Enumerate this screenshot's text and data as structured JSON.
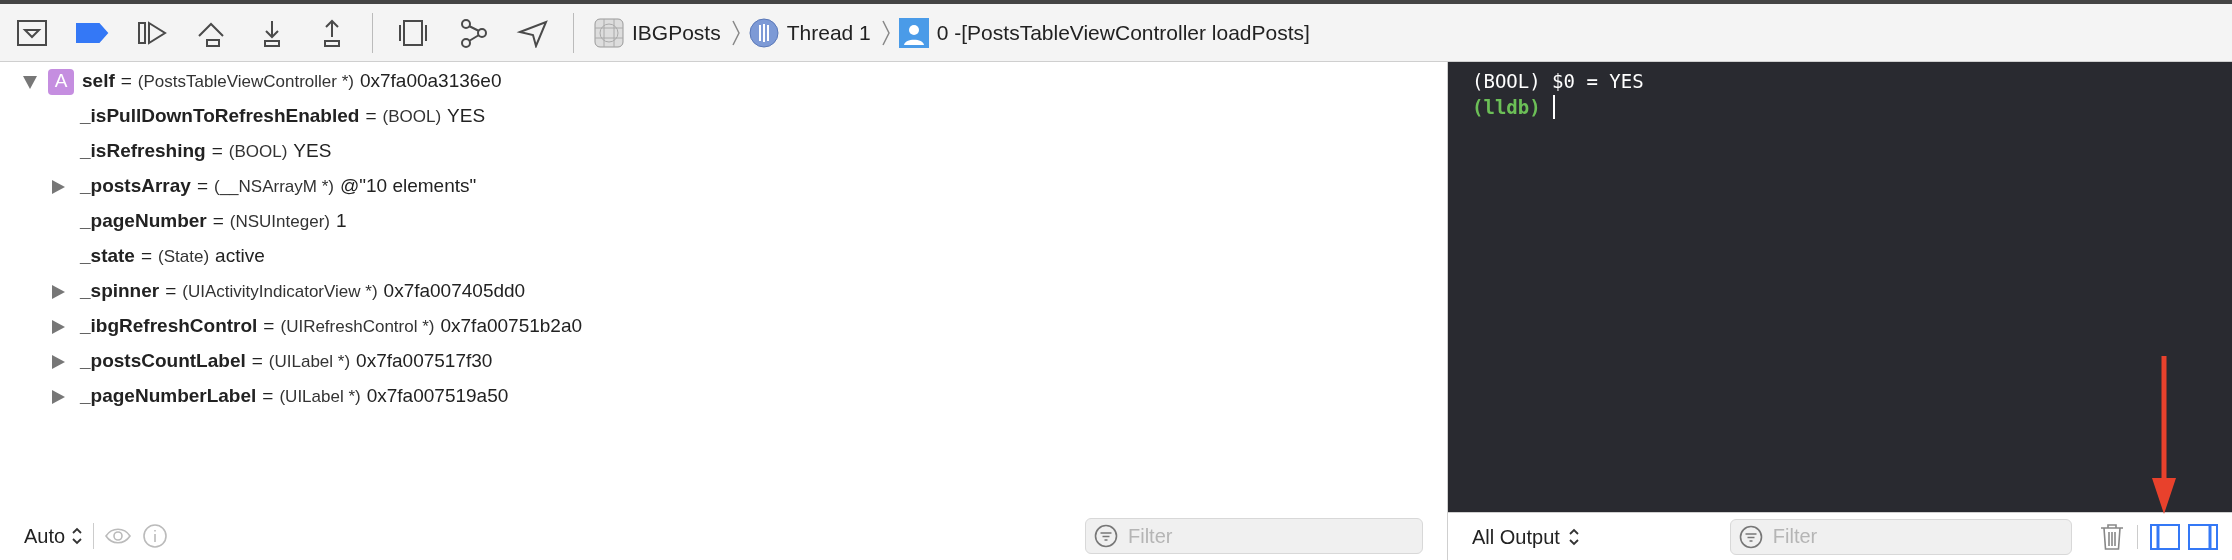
{
  "toolbar": {
    "breakpoints_active": true,
    "breadcrumbs": [
      {
        "kind": "app",
        "label": "IBGPosts"
      },
      {
        "kind": "thread",
        "label": "Thread 1"
      },
      {
        "kind": "frame",
        "label": "0 -[PostsTableViewController loadPosts]"
      }
    ]
  },
  "variables": [
    {
      "name": "self",
      "badge": "A",
      "sign": "=",
      "type": "(PostsTableViewController *)",
      "value": "0x7fa00a3136e0",
      "expanded": true,
      "children": [
        {
          "name": "_isPullDownToRefreshEnabled",
          "sign": "=",
          "type": "(BOOL)",
          "value": "YES"
        },
        {
          "name": "_isRefreshing",
          "sign": "=",
          "type": "(BOOL)",
          "value": "YES"
        },
        {
          "name": "_postsArray",
          "sign": "=",
          "type": "(__NSArrayM *)",
          "value": "@\"10 elements\"",
          "expanded": false
        },
        {
          "name": "_pageNumber",
          "sign": "=",
          "type": "(NSUInteger)",
          "value": "1"
        },
        {
          "name": "_state",
          "sign": "=",
          "type": "(State)",
          "value": "active"
        },
        {
          "name": "_spinner",
          "sign": "=",
          "type": "(UIActivityIndicatorView *)",
          "value": "0x7fa007405dd0",
          "expanded": false
        },
        {
          "name": "_ibgRefreshControl",
          "sign": "=",
          "type": "(UIRefreshControl *)",
          "value": "0x7fa00751b2a0",
          "expanded": false
        },
        {
          "name": "_postsCountLabel",
          "sign": "=",
          "type": "(UILabel *)",
          "value": "0x7fa007517f30",
          "expanded": false
        },
        {
          "name": "_pageNumberLabel",
          "sign": "=",
          "type": "(UILabel *)",
          "value": "0x7fa007519a50",
          "expanded": false
        }
      ]
    }
  ],
  "variables_bar": {
    "scope": "Auto",
    "filter": {
      "placeholder": "Filter"
    }
  },
  "console": {
    "lines": [
      {
        "kind": "output",
        "text": "(BOOL) $0 = YES"
      },
      {
        "kind": "prompt",
        "text": "(lldb)",
        "cursor": true
      }
    ]
  },
  "console_bar": {
    "output": "All Output",
    "filter": {
      "placeholder": "Filter"
    },
    "panes": [
      {
        "kind": "variables",
        "selected": true
      },
      {
        "kind": "console",
        "selected": true
      }
    ]
  }
}
